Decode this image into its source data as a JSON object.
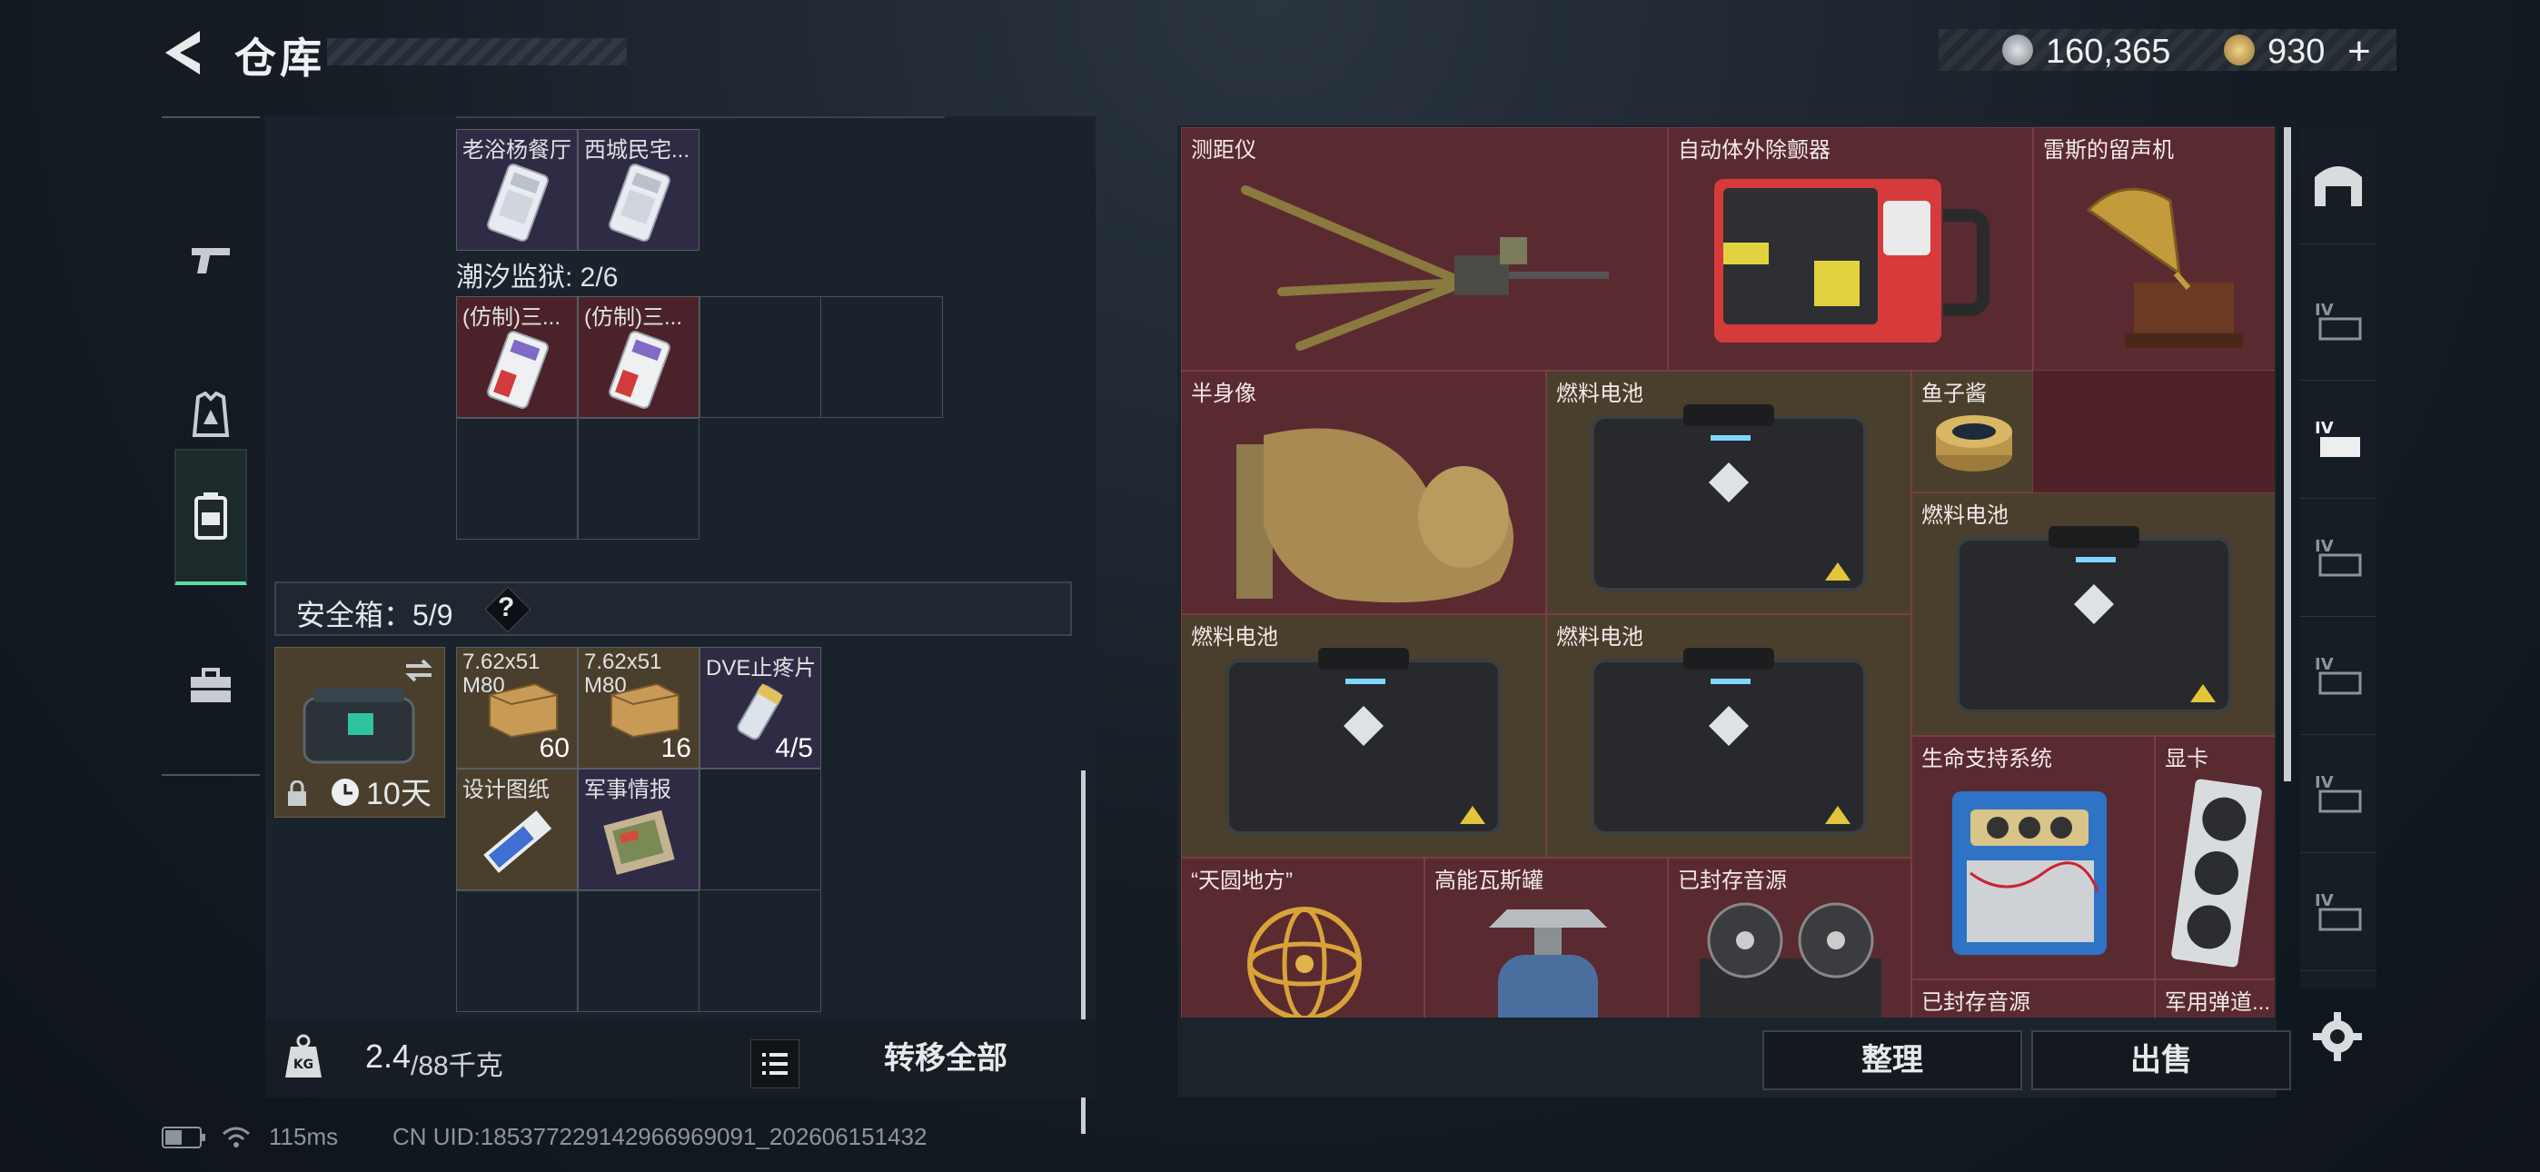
{
  "header": {
    "title": "仓库"
  },
  "currency": {
    "silver": "160,365",
    "gold": "930",
    "plus": "+"
  },
  "left_rail": [
    "weapon-tab",
    "armor-tab",
    "backpack-tab",
    "case-tab"
  ],
  "left_panel": {
    "top_items": [
      {
        "name": "老浴杨餐厅"
      },
      {
        "name": "西城民宅..."
      }
    ],
    "section_label": "潮汐监狱: 2/6",
    "prison_items": [
      {
        "name": "(仿制)三..."
      },
      {
        "name": "(仿制)三..."
      }
    ],
    "safe_box": {
      "label": "安全箱：5/9",
      "help": "?",
      "timer": "10天"
    },
    "safe_items": [
      {
        "name": "7.62x51",
        "sub": "M80",
        "qty": "60"
      },
      {
        "name": "7.62x51",
        "sub": "M80",
        "qty": "16"
      },
      {
        "name": "DVE止疼片",
        "qty": "4/5"
      },
      {
        "name": "设计图纸"
      },
      {
        "name": "军事情报"
      }
    ],
    "weight": {
      "current": "2.4",
      "max": "/88千克"
    },
    "transfer_all": "转移全部"
  },
  "right_panel": {
    "items": [
      {
        "name": "测距仪"
      },
      {
        "name": "自动体外除颤器"
      },
      {
        "name": "雷斯的留声机"
      },
      {
        "name": "半身像"
      },
      {
        "name": "燃料电池"
      },
      {
        "name": "鱼子酱"
      },
      {
        "name": "燃料电池"
      },
      {
        "name": "燃料电池"
      },
      {
        "name": "燃料电池"
      },
      {
        "name": "生命支持系统"
      },
      {
        "name": "显卡"
      },
      {
        "name": "“天圆地方”"
      },
      {
        "name": "高能瓦斯罐"
      },
      {
        "name": "已封存音源"
      },
      {
        "name": "已封存音源"
      },
      {
        "name": "军用弹道..."
      }
    ],
    "sort": "整理",
    "sell": "出售"
  },
  "status": {
    "ping": "115ms",
    "uid": "CN UID:18537722914296696909​1_202606151432"
  },
  "colors": {
    "accent_green": "#58e0a4",
    "item_red": "#5a2a31",
    "item_gold": "#4a3f2c",
    "item_purple": "#2f2b44"
  }
}
